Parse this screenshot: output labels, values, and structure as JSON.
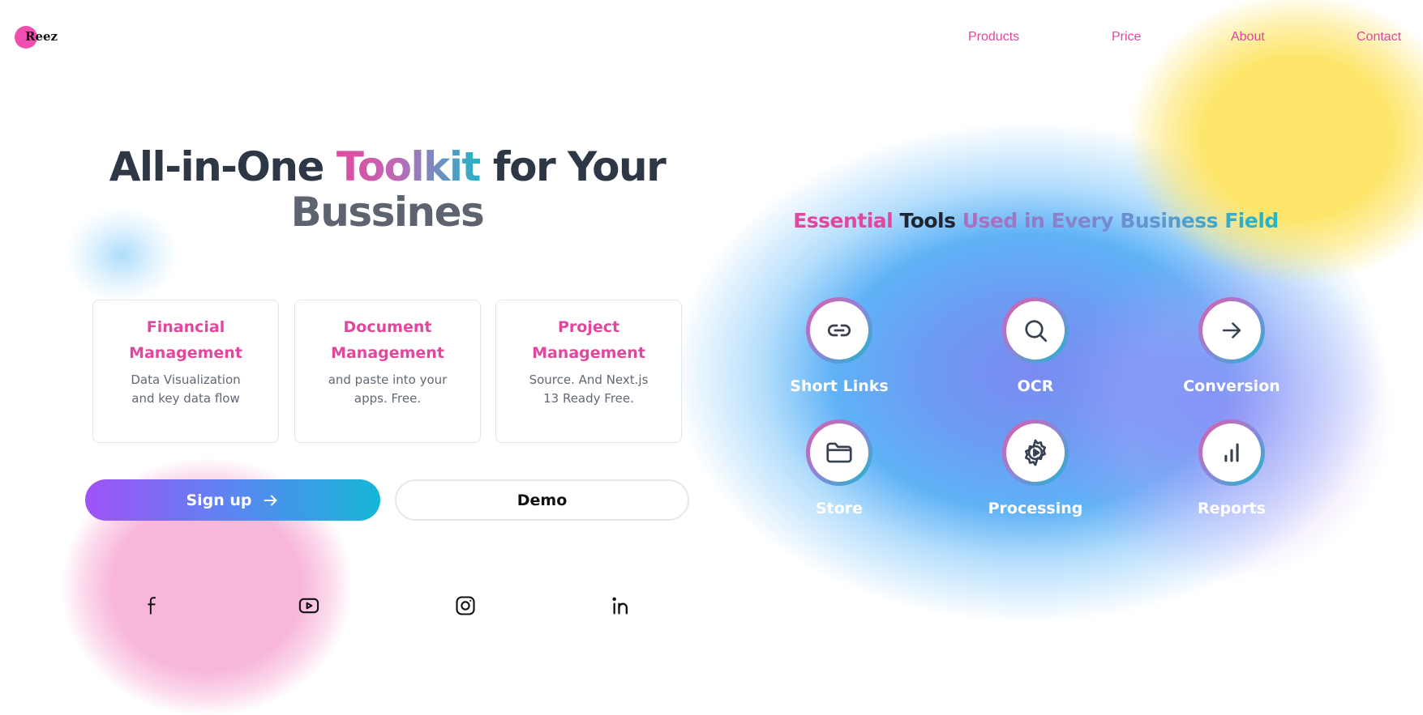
{
  "brand": {
    "logo_text": "Reez",
    "logo_color": "#f24db0",
    "accent_pink": "#e0479e"
  },
  "nav": {
    "items": [
      "Products",
      "Price",
      "About",
      "Contact"
    ]
  },
  "hero": {
    "title_part1": "All-in-One ",
    "title_highlight": "Toolkit",
    "title_part2": " for Your",
    "title_line2": "Bussines"
  },
  "cards": [
    {
      "title": "Financial Management",
      "desc": "Data Visualization and key data flow"
    },
    {
      "title": "Document Management",
      "desc": "and paste into your apps. Free."
    },
    {
      "title": "Project Management",
      "desc": "Source. And Next.js 13 Ready Free."
    }
  ],
  "buttons": {
    "signup_label": "Sign up",
    "signup_icon": "arrow-right-icon",
    "demo_label": "Demo"
  },
  "social": [
    "facebook-icon",
    "youtube-icon",
    "instagram-icon",
    "linkedin-icon"
  ],
  "tools": {
    "title_part1": "Essential",
    "title_part2": "Tools",
    "title_part3": "Used in Every Business Field",
    "items": [
      {
        "label": "Short Links",
        "icon": "link-icon"
      },
      {
        "label": "OCR",
        "icon": "search-icon"
      },
      {
        "label": "Conversion",
        "icon": "arrow-right-icon"
      },
      {
        "label": "Store",
        "icon": "folder-icon"
      },
      {
        "label": "Processing",
        "icon": "gear-play-icon"
      },
      {
        "label": "Reports",
        "icon": "bar-chart-icon"
      }
    ]
  }
}
